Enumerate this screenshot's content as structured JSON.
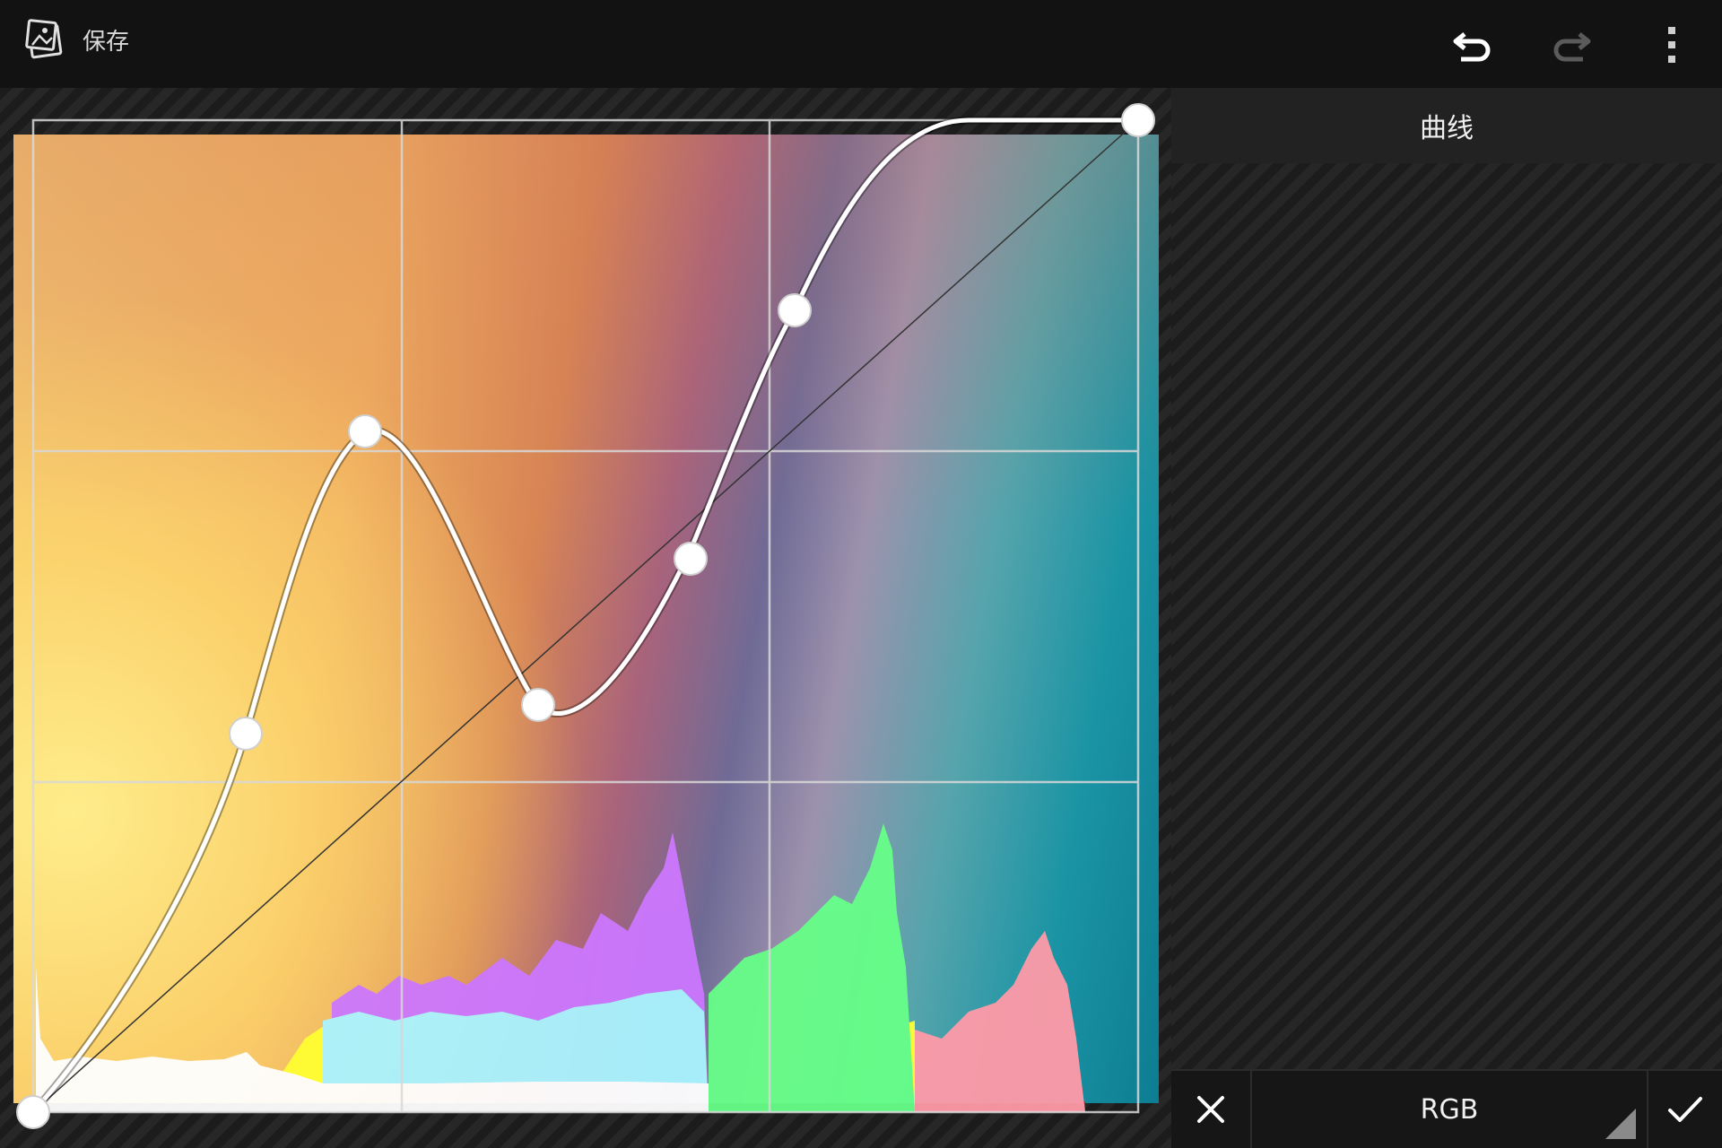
{
  "toolbar": {
    "save_label": "保存",
    "undo_icon": "undo-icon",
    "redo_icon": "redo-icon",
    "menu_icon": "overflow-menu-icon"
  },
  "panel": {
    "title": "曲线"
  },
  "bottom": {
    "channel_label": "RGB",
    "cancel_icon": "close-icon",
    "apply_icon": "check-icon"
  },
  "curve": {
    "channel": "RGB",
    "control_points": [
      {
        "input": 0,
        "output": 0
      },
      {
        "input": 0.19,
        "output": 0.38
      },
      {
        "input": 0.3,
        "output": 0.69
      },
      {
        "input": 0.46,
        "output": 0.41
      },
      {
        "input": 0.59,
        "output": 0.56
      },
      {
        "input": 0.69,
        "output": 0.81
      },
      {
        "input": 1.0,
        "output": 1.0
      }
    ]
  },
  "colors": {
    "curve": "#ffffff",
    "grid": "#d8d8d8",
    "histogram_red": "#ff0000",
    "histogram_yellow": "#ffff33",
    "histogram_green": "#66ff88",
    "histogram_cyan": "#99ffff",
    "histogram_magenta": "#cc77ff",
    "histogram_pink": "#ff99aa"
  }
}
